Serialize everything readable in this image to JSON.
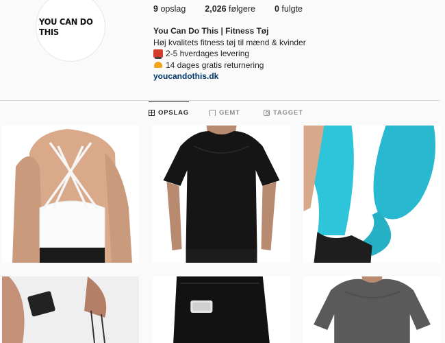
{
  "profile": {
    "avatar_text": "YOU CAN DO THIS",
    "stats": [
      {
        "value": "9",
        "label": "opslag"
      },
      {
        "value": "2,026",
        "label": "følgere"
      },
      {
        "value": "0",
        "label": "fulgte"
      }
    ],
    "name": "You Can Do This | Fitness Tøj",
    "bio_line1": "Høj kvalitets fitness tøj til mænd & kvinder",
    "bio_line2": "2-5 hverdages levering",
    "bio_line3": "14 dages gratis returnering",
    "website": "youcandothis.dk"
  },
  "tabs": [
    {
      "label": "OPSLAG",
      "icon": "grid-icon",
      "active": true
    },
    {
      "label": "GEMT",
      "icon": "bookmark-icon",
      "active": false
    },
    {
      "label": "TAGGET",
      "icon": "tag-icon",
      "active": false
    }
  ],
  "posts": [
    {
      "subject": "white sports bra"
    },
    {
      "subject": "black t-shirt"
    },
    {
      "subject": "turquoise leggings"
    },
    {
      "subject": "white shorts"
    },
    {
      "subject": "black leggings with pocket"
    },
    {
      "subject": "grey t-shirt"
    }
  ],
  "colors": {
    "link": "#00376b",
    "divider": "#dbdbdb",
    "muted": "#8e8e8e",
    "truck_emoji": "#d33c2a",
    "heart_emoji": "#f2a51a"
  }
}
